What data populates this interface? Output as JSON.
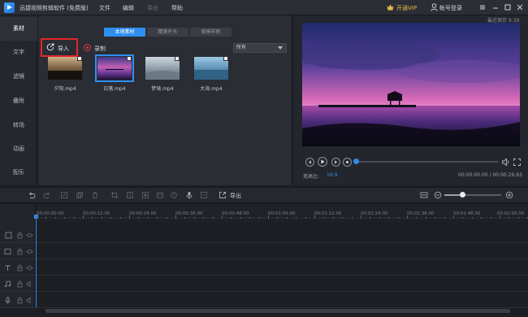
{
  "app": {
    "title": "迅捷视频剪辑软件 (免费版)",
    "menu": [
      {
        "label": "文件",
        "enabled": true
      },
      {
        "label": "编辑",
        "enabled": true
      },
      {
        "label": "导出",
        "enabled": false
      },
      {
        "label": "帮助",
        "enabled": true
      }
    ],
    "vip_label": "开通VIP",
    "login_label": "帐号登录",
    "autosave": "最近保存 9:39"
  },
  "sidebar": {
    "items": [
      {
        "label": "素材",
        "active": true
      },
      {
        "label": "文字",
        "active": false
      },
      {
        "label": "滤镜",
        "active": false
      },
      {
        "label": "叠附",
        "active": false
      },
      {
        "label": "转场",
        "active": false
      },
      {
        "label": "动画",
        "active": false
      },
      {
        "label": "配乐",
        "active": false
      }
    ]
  },
  "media": {
    "tabs": [
      {
        "label": "本地素材",
        "active": true
      },
      {
        "label": "精美片头",
        "active": false
      },
      {
        "label": "背景样例",
        "active": false
      }
    ],
    "import_label": "导入",
    "record_label": "录制",
    "filter_value": "所有",
    "files": [
      {
        "name": "夕阳.mp4",
        "selected": false
      },
      {
        "name": "日落.mp4",
        "selected": true
      },
      {
        "name": "梦境.mp4",
        "selected": false
      },
      {
        "name": "大海.mp4",
        "selected": false
      }
    ]
  },
  "preview": {
    "aspect_label": "宽高比:",
    "aspect_value": "16:9",
    "time": "00:00:00.00 / 00:00:29.93",
    "progress": 0.0
  },
  "timeline": {
    "export_label": "导出",
    "zoom_level": 0.33,
    "ruler": [
      "00:00:00.00",
      "00:00:12.00",
      "00:00:24.00",
      "00:00:36.00",
      "00:00:48.00",
      "00:01:00.00",
      "00:01:12.00",
      "00:01:24.00",
      "00:01:36.00",
      "00:01:48.00",
      "00:02:00.00"
    ]
  },
  "colors": {
    "accent": "#2f8ff0",
    "highlight_box": "#e2262b",
    "vip": "#e8b94a"
  }
}
